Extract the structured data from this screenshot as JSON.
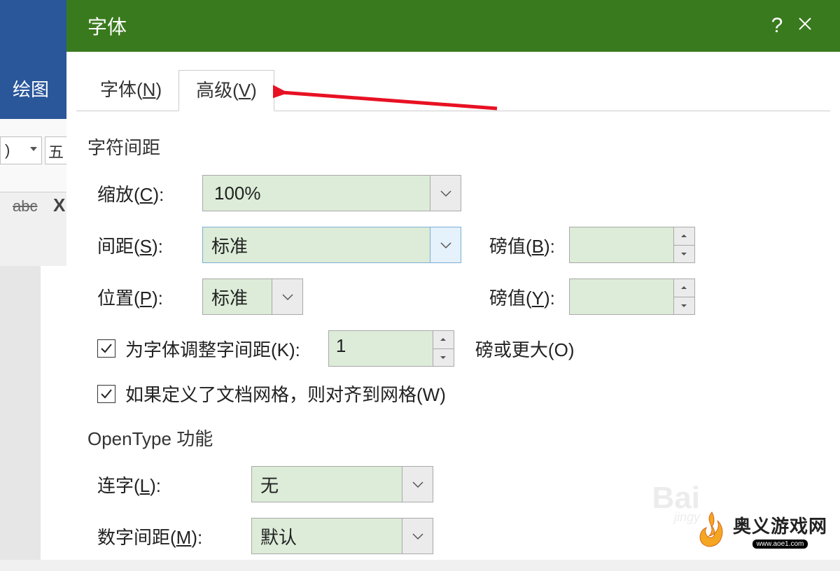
{
  "background": {
    "ribbon_tab": "绘图",
    "font_size_hint": "五",
    "strike_sample": "abc",
    "x_btn": "X"
  },
  "dialog": {
    "title": "字体",
    "help": "?",
    "tabs": {
      "font": {
        "pre": "字体(",
        "key": "N",
        "post": ")"
      },
      "advanced": {
        "pre": "高级(",
        "key": "V",
        "post": ")"
      }
    },
    "sections": {
      "char_spacing": "字符间距",
      "opentype": "OpenType 功能"
    },
    "labels": {
      "scale": {
        "pre": "缩放(",
        "key": "C",
        "post": "):"
      },
      "spacing": {
        "pre": "间距(",
        "key": "S",
        "post": "):"
      },
      "position": {
        "pre": "位置(",
        "key": "P",
        "post": "):"
      },
      "points_b": {
        "pre": "磅值(",
        "key": "B",
        "post": "):"
      },
      "points_y": {
        "pre": "磅值(",
        "key": "Y",
        "post": "):"
      },
      "kerning": {
        "pre": "为字体调整字间距(",
        "key": "K",
        "post": "):"
      },
      "points_or_more": {
        "pre": "磅或更大(",
        "key": "O",
        "post": ")"
      },
      "snap_grid": {
        "pre": "如果定义了文档网格，则对齐到网格(",
        "key": "W",
        "post": ")"
      },
      "ligatures": {
        "pre": "连字(",
        "key": "L",
        "post": "):"
      },
      "num_spacing": {
        "pre": "数字间距(",
        "key": "M",
        "post": "):"
      }
    },
    "values": {
      "scale": "100%",
      "spacing": "标准",
      "position": "标准",
      "points_b": "",
      "points_y": "",
      "kerning_points": "1",
      "ligatures": "无",
      "num_spacing": "默认"
    },
    "checks": {
      "kerning": true,
      "snap_grid": true
    }
  },
  "watermark": {
    "baidu": "Bai",
    "baidu_sub": "jingy",
    "site_name": "奥义游戏网",
    "site_url": "www.aoe1.com"
  }
}
